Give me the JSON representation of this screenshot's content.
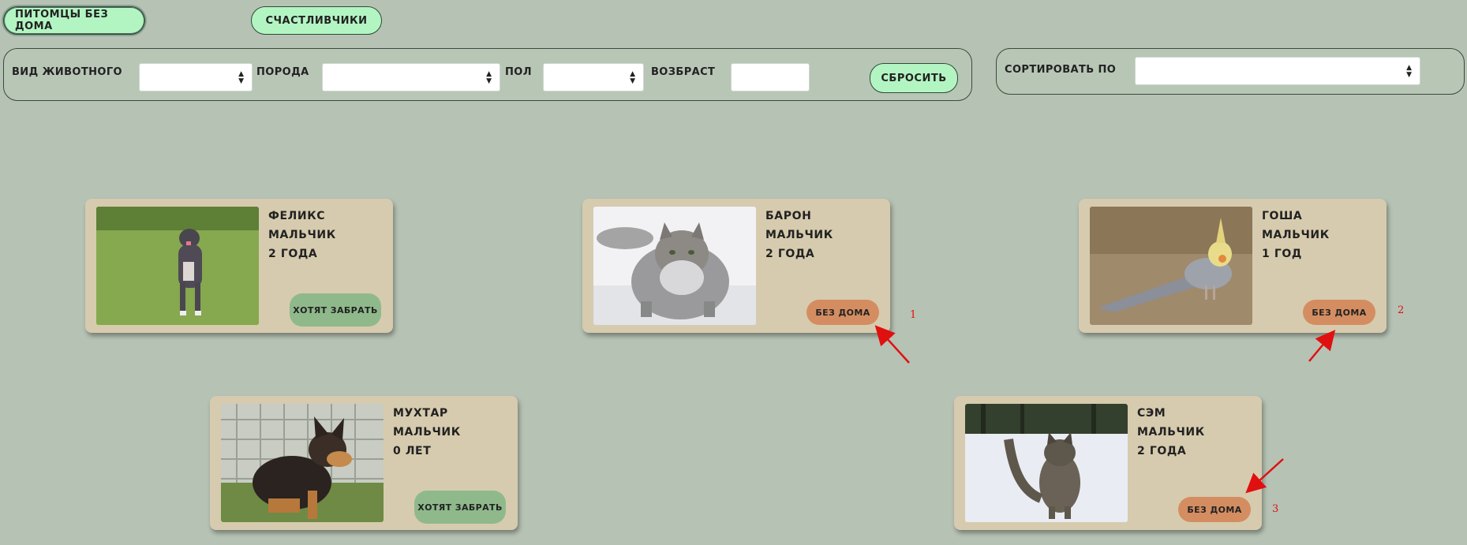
{
  "tabs": [
    {
      "label": "Питомцы без дома",
      "active": true
    },
    {
      "label": "Счастливчики",
      "active": false
    }
  ],
  "filters": {
    "animal_type_label": "Вид животного",
    "breed_label": "Порода",
    "sex_label": "Пол",
    "age_label": "Возбраст",
    "animal_type_value": "",
    "breed_value": "",
    "sex_value": "",
    "age_value": "",
    "reset_label": "Сбросить"
  },
  "sort": {
    "label": "Сортировать по",
    "value": ""
  },
  "pets": [
    {
      "name": "Феликс",
      "sex": "мальчик",
      "age": "2 года",
      "status": "Хотят забрать",
      "photo": "pitbull-dog-photo"
    },
    {
      "name": "Барон",
      "sex": "мальчик",
      "age": "2 года",
      "status": "Без дома",
      "photo": "fluffy-gray-cat-photo"
    },
    {
      "name": "Гоша",
      "sex": "мальчик",
      "age": "1 год",
      "status": "Без дома",
      "photo": "cockatiel-parrot-photo"
    },
    {
      "name": "Мухтар",
      "sex": "мальчик",
      "age": "0 лет",
      "status": "Хотят забрать",
      "photo": "shepherd-puppy-photo"
    },
    {
      "name": "Сэм",
      "sex": "мальчик",
      "age": "2 года",
      "status": "Без дома",
      "photo": "tabby-cat-snow-photo"
    }
  ],
  "annotations": [
    "1",
    "2",
    "3"
  ],
  "colors": {
    "background": "#b6c2b4",
    "tab_button": "#b3f5c2",
    "card": "#d6cbae",
    "status_wanted": "#8fb98b",
    "status_homeless": "#d48d61",
    "annotation": "#e01010"
  }
}
